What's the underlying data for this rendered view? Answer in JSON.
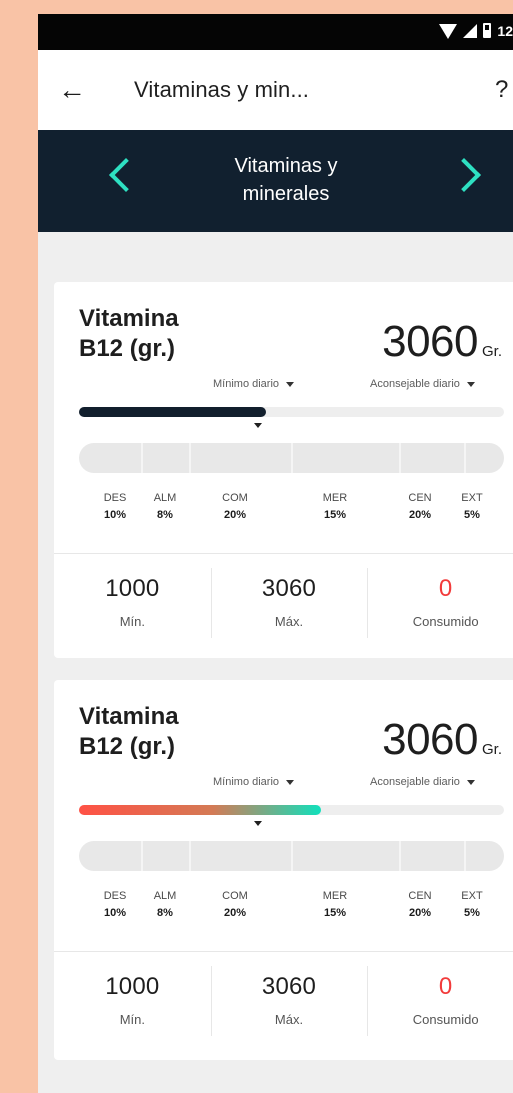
{
  "status_bar": {
    "time": "12"
  },
  "app_header": {
    "title": "Vitaminas y min..."
  },
  "category_nav": {
    "title_line_1": "Vitaminas y",
    "title_line_2": "minerales"
  },
  "cards": [
    {
      "name_line_1": "Vitamina",
      "name_line_2": "B12 (gr.)",
      "amount": "3060",
      "unit": "Gr.",
      "min_daily_label": "Mínimo diario",
      "advised_daily_label": "Aconsejable diario",
      "progress_fraction": 0.44,
      "meals": [
        {
          "name": "DES",
          "percent": "10%"
        },
        {
          "name": "ALM",
          "percent": "8%"
        },
        {
          "name": "COM",
          "percent": "20%"
        },
        {
          "name": "MER",
          "percent": "15%"
        },
        {
          "name": "CEN",
          "percent": "20%"
        },
        {
          "name": "EXT",
          "percent": "5%"
        }
      ],
      "stats": {
        "min_value": "1000",
        "min_label": "Mín.",
        "max_value": "3060",
        "max_label": "Máx.",
        "consumed_value": "0",
        "consumed_label": "Consumido"
      }
    },
    {
      "name_line_1": "Vitamina",
      "name_line_2": "B12 (gr.)",
      "amount": "3060",
      "unit": "Gr.",
      "min_daily_label": "Mínimo diario",
      "advised_daily_label": "Aconsejable diario",
      "progress_fraction": 0.57,
      "meals": [
        {
          "name": "DES",
          "percent": "10%"
        },
        {
          "name": "ALM",
          "percent": "8%"
        },
        {
          "name": "COM",
          "percent": "20%"
        },
        {
          "name": "MER",
          "percent": "15%"
        },
        {
          "name": "CEN",
          "percent": "20%"
        },
        {
          "name": "EXT",
          "percent": "5%"
        }
      ],
      "stats": {
        "min_value": "1000",
        "min_label": "Mín.",
        "max_value": "3060",
        "max_label": "Máx.",
        "consumed_value": "0",
        "consumed_label": "Consumido"
      }
    }
  ],
  "colors": {
    "background": "#f9c3a6",
    "header_dark": "#11202f",
    "accent": "#2ee0c2",
    "consumed": "#f23b3b"
  }
}
